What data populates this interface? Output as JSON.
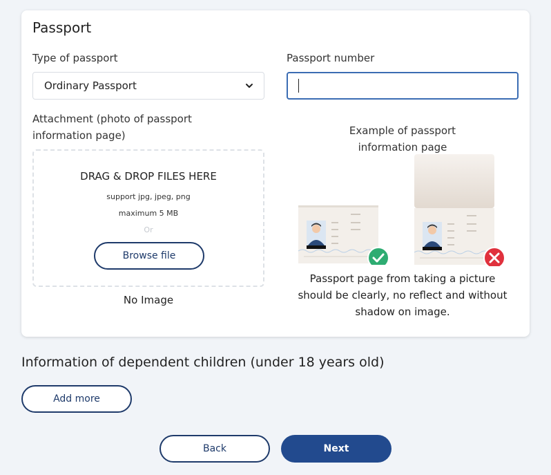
{
  "passport": {
    "title": "Passport",
    "type_label": "Type of passport",
    "type_value": "Ordinary Passport",
    "number_label": "Passport number",
    "number_value": "",
    "attachment_label_line1": "Attachment (photo of passport",
    "attachment_label_line2": "information page)",
    "dropzone": {
      "title": "DRAG & DROP FILES HERE",
      "support": "support jpg, jpeg, png",
      "max": "maximum 5 MB",
      "or": "Or",
      "browse": "Browse file"
    },
    "no_image": "No Image",
    "example_line1": "Example of passport",
    "example_line2": "information page",
    "caption_line1": "Passport page from taking a picture",
    "caption_line2": "should be clearly, no reflect and without",
    "caption_line3": "shadow on image."
  },
  "children": {
    "title": "Information of dependent children (under 18 years old)",
    "add_more": "Add more"
  },
  "nav": {
    "back": "Back",
    "next": "Next"
  },
  "colors": {
    "primary": "#224a8e",
    "outline": "#1e3a6a",
    "focus": "#3a6cb3",
    "good": "#2eac72",
    "bad": "#e0313d"
  },
  "icons": [
    "chevron-down-icon",
    "check-circle-icon",
    "x-circle-icon"
  ]
}
